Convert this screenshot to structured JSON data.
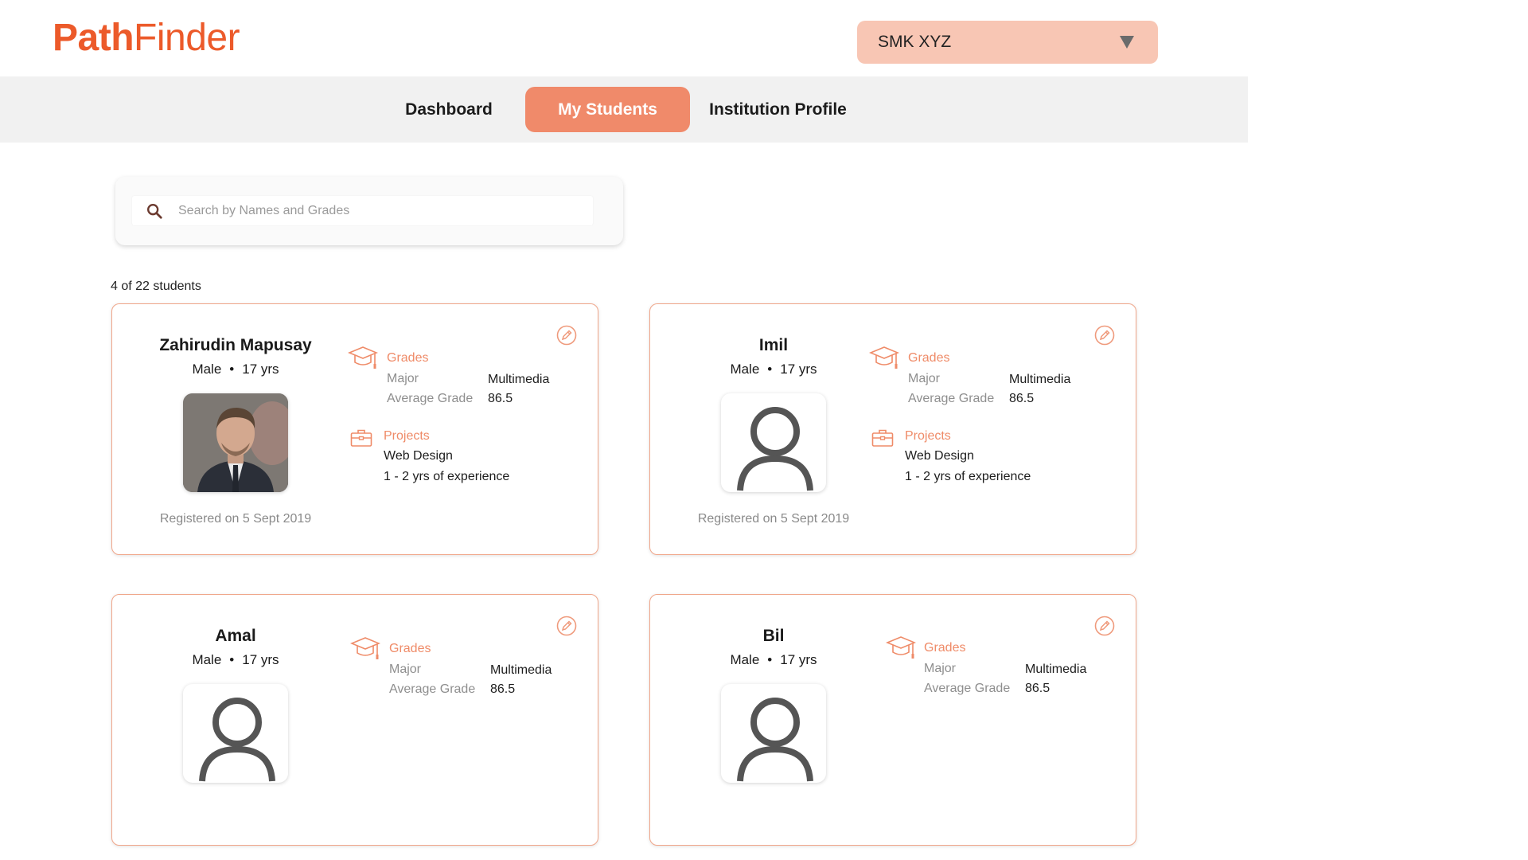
{
  "brand": {
    "part1": "Path",
    "part2": "Finder",
    "color": "#ec5a2a"
  },
  "institution_select": {
    "value": "SMK XYZ"
  },
  "nav": {
    "dashboard": "Dashboard",
    "my_students": "My Students",
    "institution_profile": "Institution Profile",
    "active": "my_students"
  },
  "search": {
    "placeholder": "Search by Names and Grades"
  },
  "students_count": "4 of 22 students",
  "students": [
    {
      "name": "Zahirudin Mapusay",
      "gender": "Male",
      "age": "17 yrs",
      "avatar": "photo",
      "grades_title": "Grades",
      "major_label": "Major",
      "major": "Multimedia",
      "avg_label": "Average Grade",
      "avg": "86.5",
      "projects_title": "Projects",
      "project": "Web Design",
      "experience": "1 - 2 yrs of experience",
      "registered": "Registered on 5 Sept 2019"
    },
    {
      "name": "Imil",
      "gender": "Male",
      "age": "17 yrs",
      "avatar": "placeholder",
      "grades_title": "Grades",
      "major_label": "Major",
      "major": "Multimedia",
      "avg_label": "Average Grade",
      "avg": "86.5",
      "projects_title": "Projects",
      "project": "Web Design",
      "experience": "1 - 2 yrs of experience",
      "registered": "Registered on 5 Sept 2019"
    },
    {
      "name": "Amal",
      "gender": "Male",
      "age": "17 yrs",
      "avatar": "placeholder",
      "grades_title": "Grades",
      "major_label": "Major",
      "major": "Multimedia",
      "avg_label": "Average Grade",
      "avg": "86.5"
    },
    {
      "name": "Bil",
      "gender": "Male",
      "age": "17 yrs",
      "avatar": "placeholder",
      "grades_title": "Grades",
      "major_label": "Major",
      "major": "Multimedia",
      "avg_label": "Average Grade",
      "avg": "86.5"
    }
  ],
  "colors": {
    "accent": "#f08a6a",
    "card_border": "#f0a68a",
    "select_bg": "#f8c6b4",
    "label_orange": "#ef8b68"
  }
}
